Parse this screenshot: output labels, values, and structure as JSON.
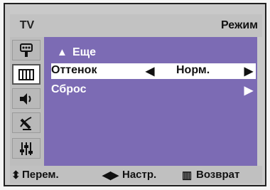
{
  "header": {
    "source_label": "TV",
    "title": "Режим"
  },
  "sidebar": {
    "items": [
      {
        "icon": "input-icon",
        "active": false
      },
      {
        "icon": "picture-icon",
        "active": true
      },
      {
        "icon": "sound-icon",
        "active": false
      },
      {
        "icon": "channel-icon",
        "active": false
      },
      {
        "icon": "setup-icon",
        "active": false
      }
    ]
  },
  "menu": {
    "more_label": "Еще",
    "rows": [
      {
        "label": "Оттенок",
        "value": "Норм.",
        "selected": true
      },
      {
        "label": "Сброс",
        "value": "",
        "selected": false
      }
    ]
  },
  "footer": {
    "move": "Перем.",
    "adjust": "Настр.",
    "back": "Возврат"
  },
  "colors": {
    "panel": "#7c6bb4",
    "frame": "#c9c9c9",
    "selected_row": "#ffffff"
  }
}
